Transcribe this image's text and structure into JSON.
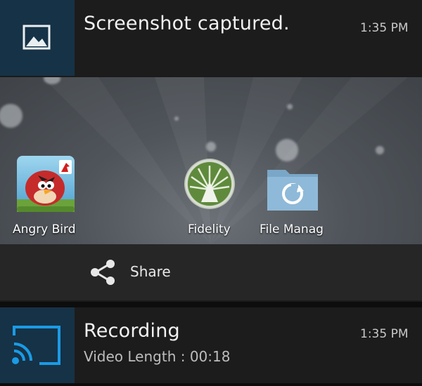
{
  "screenshot_notification": {
    "title": "Screenshot captured.",
    "time": "1:35 PM",
    "icon": "image-icon",
    "preview": {
      "apps": [
        {
          "label": "Angry Bird",
          "icon": "angry-birds-icon"
        },
        {
          "label": "Fidelity",
          "icon": "fidelity-icon"
        },
        {
          "label": "File Manag",
          "icon": "file-manager-icon"
        }
      ]
    },
    "share": {
      "label": "Share",
      "icon": "share-icon"
    }
  },
  "recording_notification": {
    "title": "Recording",
    "subtitle": "Video Length : 00:18",
    "time": "1:35 PM",
    "icon": "cast-icon"
  },
  "colors": {
    "icon_box_bg": "#163246",
    "cast_blue": "#1a9be6"
  }
}
